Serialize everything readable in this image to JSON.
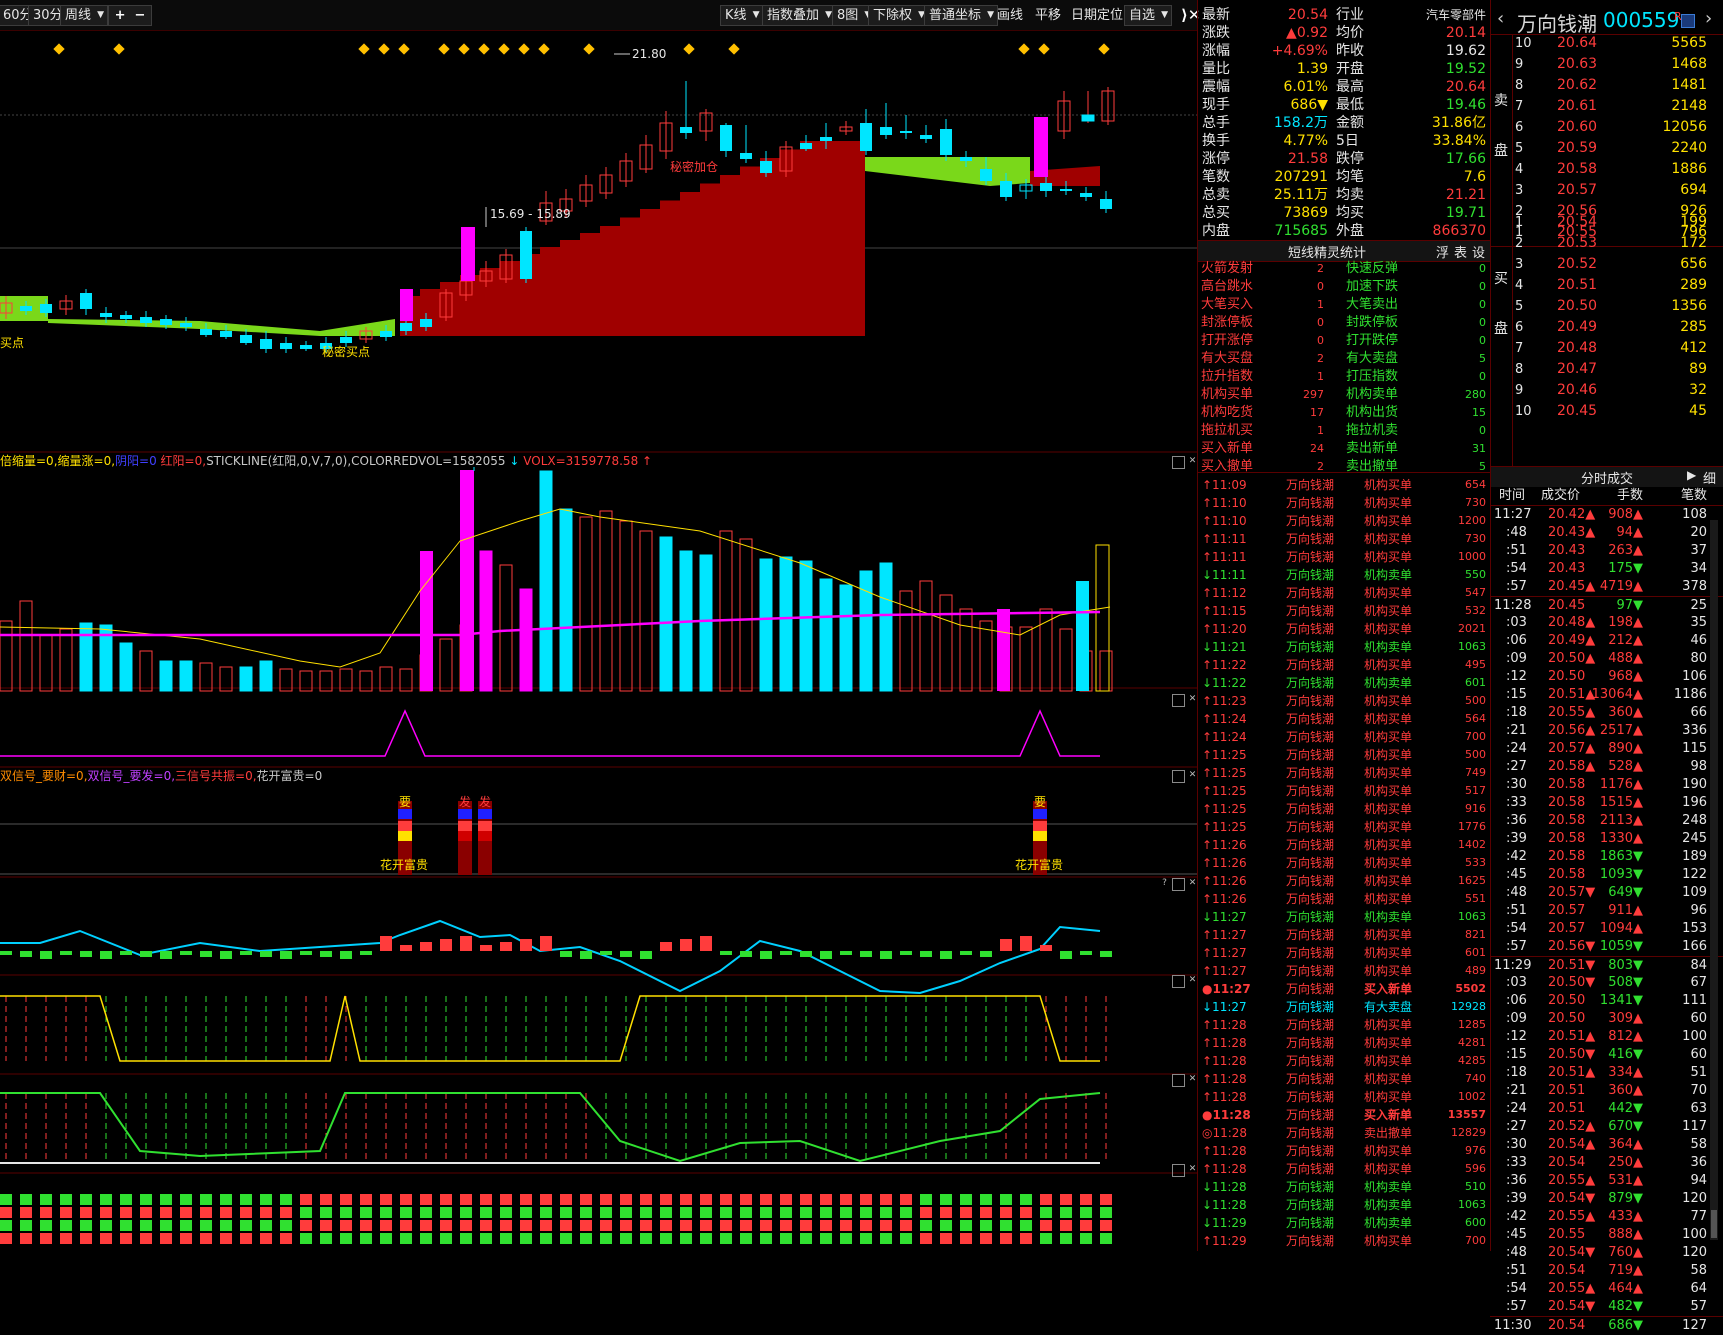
{
  "toolbar": {
    "left": [
      "60分",
      "30分",
      "周线"
    ],
    "right": [
      "K线",
      "指数叠加",
      "8图",
      "下除权",
      "普通坐标",
      "画线",
      "平移",
      "日期定位",
      "自选"
    ]
  },
  "chart": {
    "high_label": "21.80",
    "range_label": "15.69 - 15.89",
    "secret_buy": "秘密买点",
    "secret_add": "秘密加仓",
    "buy_point": "买点"
  },
  "panels": {
    "vol_header": [
      {
        "text": "倍缩量=0,",
        "color": "#ffe000"
      },
      {
        "text": "缩量涨=0,",
        "color": "#ffe000"
      },
      {
        "text": "阴阳=0",
        "color": "#4040ff"
      },
      {
        "text": " 红阳=0,",
        "color": "#ff3c3c"
      },
      {
        "text": "STICKLINE(红阳,0,V,7,0),COLORREDVOL=1582055",
        "color": "#c8c8c8"
      },
      {
        "text": " ↓ ",
        "color": "#00e6ff"
      },
      {
        "text": "VOLX=3159778.58",
        "color": "#ff3c3c"
      },
      {
        "text": " ↑",
        "color": "#ff3c3c"
      }
    ],
    "sig_header": [
      {
        "text": "双信号_要财=0,",
        "color": "#ff8c00"
      },
      {
        "text": "双信号_要发=0,",
        "color": "#c040ff"
      },
      {
        "text": "三信号共振=0,",
        "color": "#ff3c3c"
      },
      {
        "text": "花开富贵=0",
        "color": "#c8c8c8"
      }
    ],
    "sig_labels": {
      "yao": "要",
      "fa": "发",
      "da": "大",
      "flower": "花开富贵"
    }
  },
  "quote": {
    "rows": [
      {
        "l1": "最新",
        "v1": "20.54",
        "c1": "red",
        "l2": "行业",
        "v2": "汽车零部件",
        "c2": "white"
      },
      {
        "l1": "涨跌",
        "v1": "▲0.92",
        "c1": "red",
        "l2": "均价",
        "v2": "20.14",
        "c2": "red"
      },
      {
        "l1": "涨幅",
        "v1": "+4.69%",
        "c1": "red",
        "l2": "昨收",
        "v2": "19.62",
        "c2": "white"
      },
      {
        "l1": "量比",
        "v1": "1.39",
        "c1": "yellow",
        "l2": "开盘",
        "v2": "19.52",
        "c2": "green"
      },
      {
        "l1": "震幅",
        "v1": "6.01%",
        "c1": "yellow",
        "l2": "最高",
        "v2": "20.64",
        "c2": "red"
      },
      {
        "l1": "现手",
        "v1": "686▼",
        "c1": "yellow",
        "l2": "最低",
        "v2": "19.46",
        "c2": "green"
      },
      {
        "l1": "总手",
        "v1": "158.2万",
        "c1": "cyan",
        "l2": "金额",
        "v2": "31.86亿",
        "c2": "yellow"
      },
      {
        "l1": "换手",
        "v1": "4.77%",
        "c1": "yellow",
        "l2": "5日",
        "v2": "33.84%",
        "c2": "yellow"
      },
      {
        "l1": "涨停",
        "v1": "21.58",
        "c1": "red",
        "l2": "跌停",
        "v2": "17.66",
        "c2": "green"
      },
      {
        "l1": "笔数",
        "v1": "207291",
        "c1": "yellow",
        "l2": "均笔",
        "v2": "7.6",
        "c2": "yellow"
      },
      {
        "l1": "总卖",
        "v1": "25.11万",
        "c1": "yellow",
        "l2": "均卖",
        "v2": "21.21",
        "c2": "red"
      },
      {
        "l1": "总买",
        "v1": "73869",
        "c1": "yellow",
        "l2": "均买",
        "v2": "19.71",
        "c2": "green"
      },
      {
        "l1": "内盘",
        "v1": "715685",
        "c1": "green",
        "l2": "外盘",
        "v2": "866370",
        "c2": "red"
      }
    ]
  },
  "stats": {
    "title": "短线精灵统计",
    "tabs": [
      "浮",
      "表",
      "设"
    ],
    "rows": [
      {
        "a": "火箭发射",
        "av": "2",
        "b": "快速反弹",
        "bv": "0"
      },
      {
        "a": "高台跳水",
        "av": "0",
        "b": "加速下跌",
        "bv": "0"
      },
      {
        "a": "大笔买入",
        "av": "1",
        "b": "大笔卖出",
        "bv": "0"
      },
      {
        "a": "封涨停板",
        "av": "0",
        "b": "封跌停板",
        "bv": "0"
      },
      {
        "a": "打开涨停",
        "av": "0",
        "b": "打开跌停",
        "bv": "0"
      },
      {
        "a": "有大买盘",
        "av": "2",
        "b": "有大卖盘",
        "bv": "5"
      },
      {
        "a": "拉升指数",
        "av": "1",
        "b": "打压指数",
        "bv": "0"
      },
      {
        "a": "机构买单",
        "av": "297",
        "b": "机构卖单",
        "bv": "280"
      },
      {
        "a": "机构吃货",
        "av": "17",
        "b": "机构出货",
        "bv": "15"
      },
      {
        "a": "拖拉机买",
        "av": "1",
        "b": "拖拉机卖",
        "bv": "0"
      },
      {
        "a": "买入新单",
        "av": "24",
        "b": "卖出新单",
        "bv": "31"
      },
      {
        "a": "买入撤单",
        "av": "2",
        "b": "卖出撤单",
        "bv": "5"
      }
    ]
  },
  "tape": {
    "name": "万向钱潮",
    "rows": [
      {
        "t": "↑11:09",
        "e": "机构买单",
        "v": "654",
        "c": "red"
      },
      {
        "t": "↑11:10",
        "e": "机构买单",
        "v": "730",
        "c": "red"
      },
      {
        "t": "↑11:10",
        "e": "机构买单",
        "v": "1200",
        "c": "red"
      },
      {
        "t": "↑11:11",
        "e": "机构买单",
        "v": "730",
        "c": "red"
      },
      {
        "t": "↑11:11",
        "e": "机构买单",
        "v": "1000",
        "c": "red"
      },
      {
        "t": "↓11:11",
        "e": "机构卖单",
        "v": "550",
        "c": "green"
      },
      {
        "t": "↑11:12",
        "e": "机构买单",
        "v": "547",
        "c": "red"
      },
      {
        "t": "↑11:15",
        "e": "机构买单",
        "v": "532",
        "c": "red"
      },
      {
        "t": "↑11:20",
        "e": "机构买单",
        "v": "2021",
        "c": "red"
      },
      {
        "t": "↓11:21",
        "e": "机构卖单",
        "v": "1063",
        "c": "green"
      },
      {
        "t": "↑11:22",
        "e": "机构买单",
        "v": "495",
        "c": "red"
      },
      {
        "t": "↓11:22",
        "e": "机构卖单",
        "v": "601",
        "c": "green"
      },
      {
        "t": "↑11:23",
        "e": "机构买单",
        "v": "500",
        "c": "red"
      },
      {
        "t": "↑11:24",
        "e": "机构买单",
        "v": "564",
        "c": "red"
      },
      {
        "t": "↑11:24",
        "e": "机构买单",
        "v": "700",
        "c": "red"
      },
      {
        "t": "↑11:25",
        "e": "机构买单",
        "v": "500",
        "c": "red"
      },
      {
        "t": "↑11:25",
        "e": "机构买单",
        "v": "749",
        "c": "red"
      },
      {
        "t": "↑11:25",
        "e": "机构买单",
        "v": "517",
        "c": "red"
      },
      {
        "t": "↑11:25",
        "e": "机构买单",
        "v": "916",
        "c": "red"
      },
      {
        "t": "↑11:25",
        "e": "机构买单",
        "v": "1776",
        "c": "red"
      },
      {
        "t": "↑11:26",
        "e": "机构买单",
        "v": "1402",
        "c": "red"
      },
      {
        "t": "↑11:26",
        "e": "机构买单",
        "v": "533",
        "c": "red"
      },
      {
        "t": "↑11:26",
        "e": "机构买单",
        "v": "1625",
        "c": "red"
      },
      {
        "t": "↑11:26",
        "e": "机构买单",
        "v": "551",
        "c": "red"
      },
      {
        "t": "↓11:27",
        "e": "机构卖单",
        "v": "1063",
        "c": "green"
      },
      {
        "t": "↑11:27",
        "e": "机构买单",
        "v": "821",
        "c": "red"
      },
      {
        "t": "↑11:27",
        "e": "机构买单",
        "v": "601",
        "c": "red"
      },
      {
        "t": "↑11:27",
        "e": "机构买单",
        "v": "489",
        "c": "red"
      },
      {
        "t": "●11:27",
        "e": "买入新单",
        "v": "5502",
        "c": "red",
        "bold": true
      },
      {
        "t": "↓11:27",
        "e": "有大卖盘",
        "v": "12928",
        "c": "cyan"
      },
      {
        "t": "↑11:28",
        "e": "机构买单",
        "v": "1285",
        "c": "red"
      },
      {
        "t": "↑11:28",
        "e": "机构买单",
        "v": "4281",
        "c": "red"
      },
      {
        "t": "↑11:28",
        "e": "机构买单",
        "v": "4285",
        "c": "red"
      },
      {
        "t": "↑11:28",
        "e": "机构买单",
        "v": "740",
        "c": "red"
      },
      {
        "t": "↑11:28",
        "e": "机构买单",
        "v": "1002",
        "c": "red"
      },
      {
        "t": "●11:28",
        "e": "买入新单",
        "v": "13557",
        "c": "red",
        "bold": true
      },
      {
        "t": "◎11:28",
        "e": "卖出撤单",
        "v": "12829",
        "c": "red"
      },
      {
        "t": "↑11:28",
        "e": "机构买单",
        "v": "976",
        "c": "red"
      },
      {
        "t": "↑11:28",
        "e": "机构买单",
        "v": "596",
        "c": "red"
      },
      {
        "t": "↓11:28",
        "e": "机构卖单",
        "v": "510",
        "c": "green"
      },
      {
        "t": "↓11:28",
        "e": "机构卖单",
        "v": "1063",
        "c": "green"
      },
      {
        "t": "↓11:29",
        "e": "机构卖单",
        "v": "600",
        "c": "green"
      },
      {
        "t": "↑11:29",
        "e": "机构买单",
        "v": "700",
        "c": "red"
      }
    ]
  },
  "stock": {
    "name": "万向钱潮",
    "code": "000559",
    "badge": "R",
    "ask_label": [
      "卖",
      "盘"
    ],
    "bid_label": [
      "买",
      "盘"
    ]
  },
  "asks": [
    {
      "n": "10",
      "p": "20.64",
      "v": "5565"
    },
    {
      "n": "9",
      "p": "20.63",
      "v": "1468"
    },
    {
      "n": "8",
      "p": "20.62",
      "v": "1481"
    },
    {
      "n": "7",
      "p": "20.61",
      "v": "2148"
    },
    {
      "n": "6",
      "p": "20.60",
      "v": "12056"
    },
    {
      "n": "5",
      "p": "20.59",
      "v": "2240"
    },
    {
      "n": "4",
      "p": "20.58",
      "v": "1886"
    },
    {
      "n": "3",
      "p": "20.57",
      "v": "694"
    },
    {
      "n": "2",
      "p": "20.56",
      "v": "926"
    },
    {
      "n": "1",
      "p": "20.55",
      "v": "796"
    }
  ],
  "bids": [
    {
      "n": "1",
      "p": "20.54",
      "v": "199"
    },
    {
      "n": "2",
      "p": "20.53",
      "v": "172"
    },
    {
      "n": "3",
      "p": "20.52",
      "v": "656"
    },
    {
      "n": "4",
      "p": "20.51",
      "v": "289"
    },
    {
      "n": "5",
      "p": "20.50",
      "v": "1356"
    },
    {
      "n": "6",
      "p": "20.49",
      "v": "285"
    },
    {
      "n": "7",
      "p": "20.48",
      "v": "412"
    },
    {
      "n": "8",
      "p": "20.47",
      "v": "89"
    },
    {
      "n": "9",
      "p": "20.46",
      "v": "32"
    },
    {
      "n": "10",
      "p": "20.45",
      "v": "45"
    }
  ],
  "trades": {
    "title": "分时成交",
    "detail": "细",
    "cols": [
      "时间",
      "成交价",
      "手数",
      "笔数"
    ],
    "rows": [
      {
        "t": "11:27",
        "p": "20.42▲",
        "v": "908▲",
        "n": "108",
        "c": "red"
      },
      {
        "t": ":48",
        "p": "20.43▲",
        "v": "94▲",
        "n": "20",
        "c": "red"
      },
      {
        "t": ":51",
        "p": "20.43",
        "v": "263▲",
        "n": "37",
        "c": "red"
      },
      {
        "t": ":54",
        "p": "20.43",
        "v": "175▼",
        "n": "34",
        "c": "green"
      },
      {
        "t": ":57",
        "p": "20.45▲",
        "v": "4719▲",
        "n": "378",
        "c": "red"
      },
      {
        "t": "11:28",
        "p": "20.45",
        "v": "97▼",
        "n": "25",
        "c": "green",
        "sep": true
      },
      {
        "t": ":03",
        "p": "20.48▲",
        "v": "198▲",
        "n": "35",
        "c": "red"
      },
      {
        "t": ":06",
        "p": "20.49▲",
        "v": "212▲",
        "n": "46",
        "c": "red"
      },
      {
        "t": ":09",
        "p": "20.50▲",
        "v": "488▲",
        "n": "80",
        "c": "red"
      },
      {
        "t": ":12",
        "p": "20.50",
        "v": "968▲",
        "n": "106",
        "c": "red"
      },
      {
        "t": ":15",
        "p": "20.51▲",
        "v": "13064▲",
        "n": "1186",
        "c": "red"
      },
      {
        "t": ":18",
        "p": "20.55▲",
        "v": "360▲",
        "n": "66",
        "c": "red"
      },
      {
        "t": ":21",
        "p": "20.56▲",
        "v": "2517▲",
        "n": "336",
        "c": "red"
      },
      {
        "t": ":24",
        "p": "20.57▲",
        "v": "890▲",
        "n": "115",
        "c": "red"
      },
      {
        "t": ":27",
        "p": "20.58▲",
        "v": "528▲",
        "n": "98",
        "c": "red"
      },
      {
        "t": ":30",
        "p": "20.58",
        "v": "1176▲",
        "n": "190",
        "c": "red"
      },
      {
        "t": ":33",
        "p": "20.58",
        "v": "1515▲",
        "n": "196",
        "c": "red"
      },
      {
        "t": ":36",
        "p": "20.58",
        "v": "2113▲",
        "n": "248",
        "c": "red"
      },
      {
        "t": ":39",
        "p": "20.58",
        "v": "1330▲",
        "n": "245",
        "c": "red"
      },
      {
        "t": ":42",
        "p": "20.58",
        "v": "1863▼",
        "n": "189",
        "c": "green"
      },
      {
        "t": ":45",
        "p": "20.58",
        "v": "1093▼",
        "n": "122",
        "c": "green"
      },
      {
        "t": ":48",
        "p": "20.57▼",
        "v": "649▼",
        "n": "109",
        "c": "green"
      },
      {
        "t": ":51",
        "p": "20.57",
        "v": "911▲",
        "n": "96",
        "c": "red"
      },
      {
        "t": ":54",
        "p": "20.57",
        "v": "1094▲",
        "n": "153",
        "c": "red"
      },
      {
        "t": ":57",
        "p": "20.56▼",
        "v": "1059▼",
        "n": "166",
        "c": "green"
      },
      {
        "t": "11:29",
        "p": "20.51▼",
        "v": "803▼",
        "n": "84",
        "c": "green",
        "sep": true
      },
      {
        "t": ":03",
        "p": "20.50▼",
        "v": "508▼",
        "n": "67",
        "c": "green"
      },
      {
        "t": ":06",
        "p": "20.50",
        "v": "1341▼",
        "n": "111",
        "c": "green"
      },
      {
        "t": ":09",
        "p": "20.50",
        "v": "309▲",
        "n": "60",
        "c": "red"
      },
      {
        "t": ":12",
        "p": "20.51▲",
        "v": "812▲",
        "n": "100",
        "c": "red"
      },
      {
        "t": ":15",
        "p": "20.50▼",
        "v": "416▼",
        "n": "60",
        "c": "green"
      },
      {
        "t": ":18",
        "p": "20.51▲",
        "v": "334▲",
        "n": "51",
        "c": "red"
      },
      {
        "t": ":21",
        "p": "20.51",
        "v": "360▲",
        "n": "70",
        "c": "red"
      },
      {
        "t": ":24",
        "p": "20.51",
        "v": "442▼",
        "n": "63",
        "c": "green"
      },
      {
        "t": ":27",
        "p": "20.52▲",
        "v": "670▼",
        "n": "117",
        "c": "green"
      },
      {
        "t": ":30",
        "p": "20.54▲",
        "v": "364▲",
        "n": "58",
        "c": "red"
      },
      {
        "t": ":33",
        "p": "20.54",
        "v": "250▲",
        "n": "36",
        "c": "red"
      },
      {
        "t": ":36",
        "p": "20.55▲",
        "v": "531▲",
        "n": "94",
        "c": "red"
      },
      {
        "t": ":39",
        "p": "20.54▼",
        "v": "879▼",
        "n": "120",
        "c": "green"
      },
      {
        "t": ":42",
        "p": "20.55▲",
        "v": "433▲",
        "n": "77",
        "c": "red"
      },
      {
        "t": ":45",
        "p": "20.55",
        "v": "888▲",
        "n": "100",
        "c": "red"
      },
      {
        "t": ":48",
        "p": "20.54▼",
        "v": "760▲",
        "n": "120",
        "c": "red"
      },
      {
        "t": ":51",
        "p": "20.54",
        "v": "719▲",
        "n": "58",
        "c": "red"
      },
      {
        "t": ":54",
        "p": "20.55▲",
        "v": "464▲",
        "n": "64",
        "c": "red"
      },
      {
        "t": ":57",
        "p": "20.54▼",
        "v": "482▼",
        "n": "57",
        "c": "green"
      },
      {
        "t": "11:30",
        "p": "20.54",
        "v": "686▼",
        "n": "127",
        "c": "green",
        "sep": true
      }
    ]
  },
  "colors": {
    "up": "#ff3c3c",
    "down": "#00e6ff",
    "accent": "#ff00ff",
    "grid": "#5a0000"
  }
}
